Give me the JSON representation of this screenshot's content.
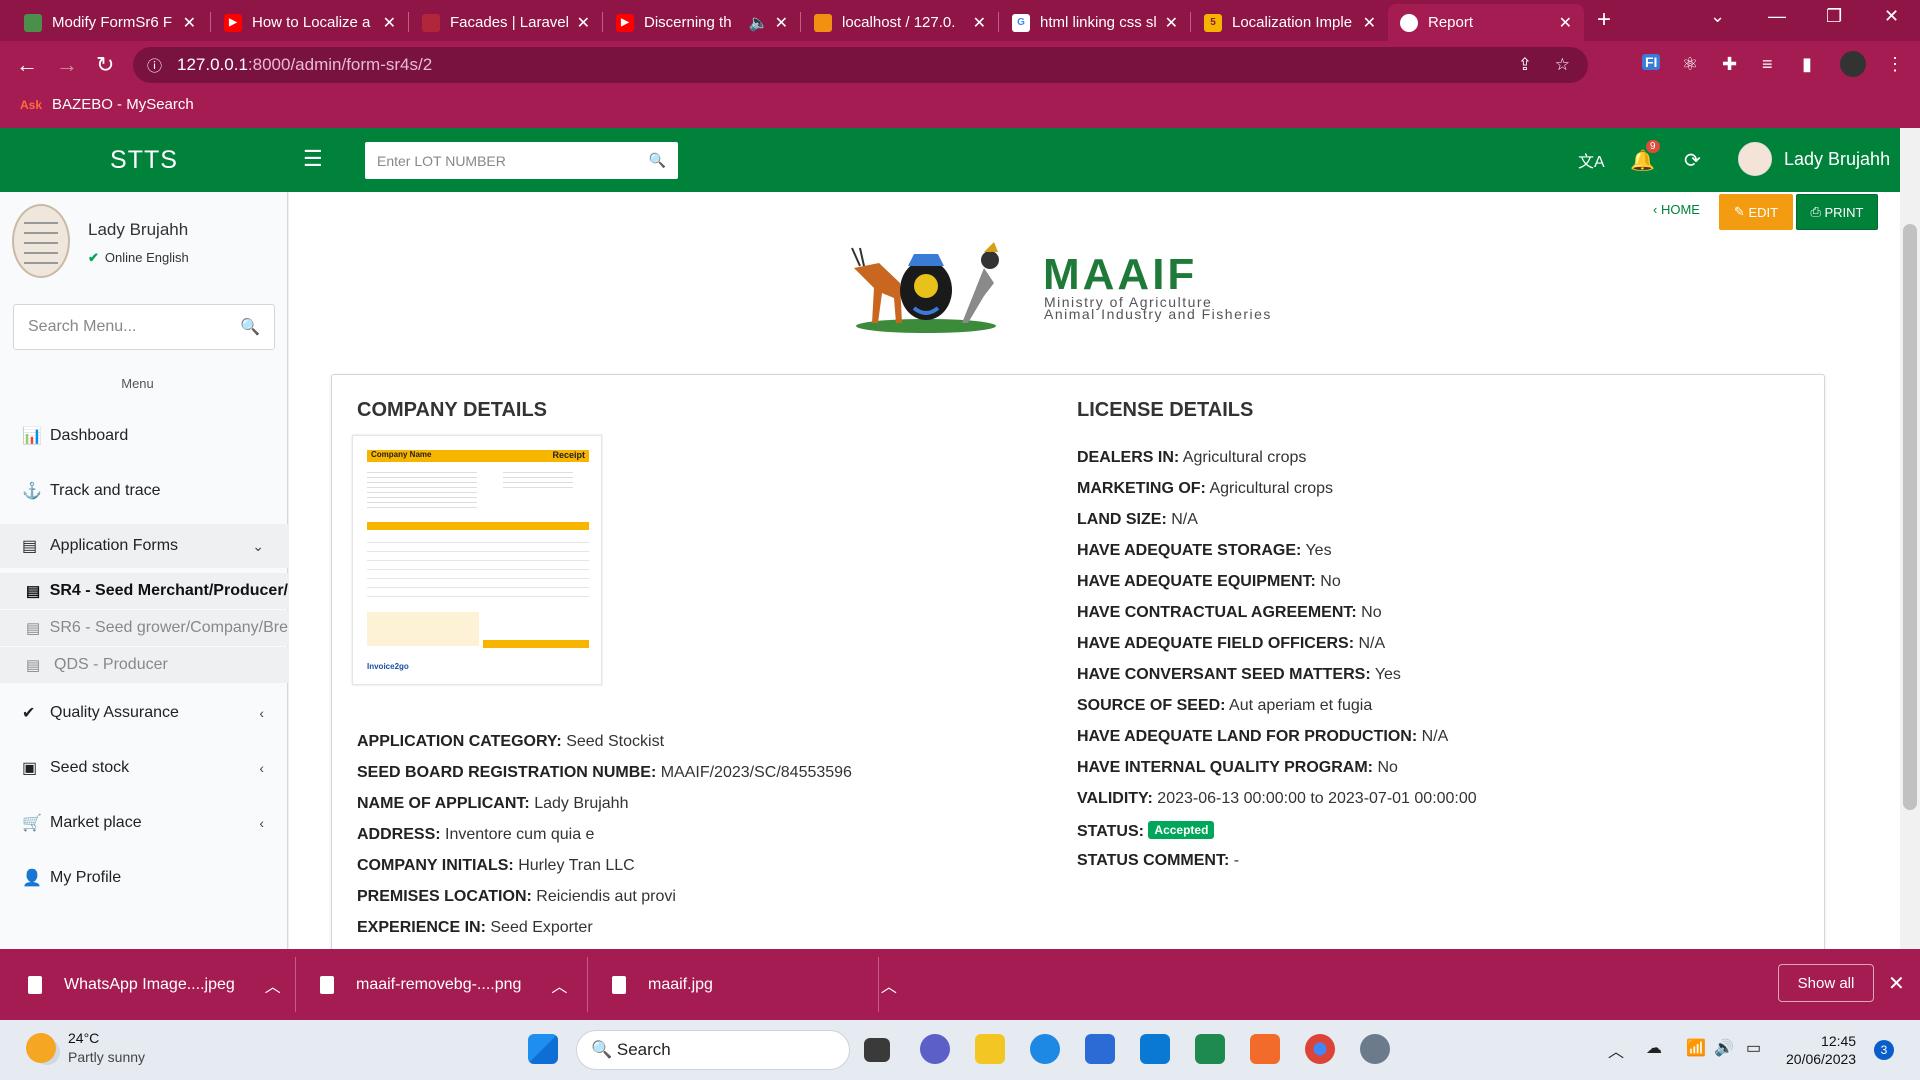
{
  "browser": {
    "tabs": [
      {
        "title": "Modify FormSr6 F",
        "icon": "globe-icon",
        "color": "#4a8f4a"
      },
      {
        "title": "How to Localize a",
        "icon": "youtube-icon",
        "color": "#ff0000"
      },
      {
        "title": "Facades | Laravel",
        "icon": "laravel-icon",
        "color": "#b2263b"
      },
      {
        "title": "Discerning th",
        "icon": "youtube-icon",
        "color": "#ff0000"
      },
      {
        "title": "localhost / 127.0.",
        "icon": "phpmyadmin-icon",
        "color": "#f29111"
      },
      {
        "title": "html linking css sl",
        "icon": "google-icon",
        "color": "#4285f4"
      },
      {
        "title": "Localization Imple",
        "icon": "tab-s-icon",
        "color": "#f5b400"
      },
      {
        "title": "Report",
        "icon": "globe-icon",
        "color": "#ffffff"
      }
    ],
    "url_host": "127.0.0.1",
    "url_path": ":8000/admin/form-sr4s/2",
    "bookmark": "BAZEBO - MySearch",
    "bookmark_icon": "Ask"
  },
  "header": {
    "logo": "STTS",
    "search_placeholder": "Enter LOT NUMBER",
    "notification_count": "9",
    "user_name": "Lady Brujahh"
  },
  "sidebar": {
    "user_name": "Lady Brujahh",
    "status": "Online English",
    "search_placeholder": "Search Menu...",
    "menu_header": "Menu",
    "items": [
      {
        "label": "Dashboard",
        "icon": "bar-chart-icon"
      },
      {
        "label": "Track and trace",
        "icon": "anchor-icon"
      },
      {
        "label": "Application Forms",
        "icon": "form-icon"
      },
      {
        "label": "Quality Assurance",
        "icon": "check-icon"
      },
      {
        "label": "Seed stock",
        "icon": "inbox-icon"
      },
      {
        "label": "Market place",
        "icon": "cart-icon"
      },
      {
        "label": "My Profile",
        "icon": "user-icon"
      }
    ],
    "subitems": [
      {
        "label": "SR4 - Seed Merchant/Producer/"
      },
      {
        "label": "SR6 - Seed grower/Company/Bre"
      },
      {
        "label": "QDS - Producer"
      }
    ]
  },
  "actions": {
    "home": "HOME",
    "edit": "EDIT",
    "print": "PRINT"
  },
  "brand": {
    "title": "MAAIF",
    "subtitle_1": "Ministry of Agriculture",
    "subtitle_2": "Animal Industry and Fisheries"
  },
  "company": {
    "heading": "COMPANY DETAILS",
    "receipt": {
      "company": "Company Name",
      "title": "Receipt",
      "footer": "Invoice2go"
    },
    "fields": [
      {
        "label": "APPLICATION CATEGORY:",
        "value": "Seed Stockist"
      },
      {
        "label": "SEED BOARD REGISTRATION NUMBE:",
        "value": "MAAIF/2023/SC/84553596"
      },
      {
        "label": "NAME OF APPLICANT:",
        "value": "Lady Brujahh"
      },
      {
        "label": "ADDRESS:",
        "value": "Inventore cum quia e"
      },
      {
        "label": "COMPANY INITIALS:",
        "value": "Hurley Tran LLC"
      },
      {
        "label": "PREMISES LOCATION:",
        "value": "Reiciendis aut provi"
      },
      {
        "label": "EXPERIENCE IN:",
        "value": "Seed Exporter"
      }
    ]
  },
  "license": {
    "heading": "LICENSE DETAILS",
    "fields": [
      {
        "label": "DEALERS IN:",
        "value": "Agricultural crops"
      },
      {
        "label": "MARKETING OF:",
        "value": "Agricultural crops"
      },
      {
        "label": "LAND SIZE:",
        "value": "N/A"
      },
      {
        "label": "HAVE ADEQUATE STORAGE:",
        "value": "Yes"
      },
      {
        "label": "HAVE ADEQUATE EQUIPMENT:",
        "value": "No"
      },
      {
        "label": "HAVE CONTRACTUAL AGREEMENT:",
        "value": "No"
      },
      {
        "label": "HAVE ADEQUATE FIELD OFFICERS:",
        "value": "N/A"
      },
      {
        "label": "HAVE CONVERSANT SEED MATTERS:",
        "value": "Yes"
      },
      {
        "label": "SOURCE OF SEED:",
        "value": "Aut aperiam et fugia"
      },
      {
        "label": "HAVE ADEQUATE LAND FOR PRODUCTION:",
        "value": "N/A"
      },
      {
        "label": "HAVE INTERNAL QUALITY PROGRAM:",
        "value": "No"
      },
      {
        "label": "VALIDITY:",
        "value": "2023-06-13 00:00:00 to 2023-07-01 00:00:00"
      },
      {
        "label": "STATUS:",
        "value": "Accepted"
      },
      {
        "label": "STATUS COMMENT:",
        "value": "-"
      }
    ]
  },
  "downloads": {
    "files": [
      "WhatsApp Image....jpeg",
      "maaif-removebg-....png",
      "maaif.jpg"
    ],
    "show_all": "Show all"
  },
  "taskbar": {
    "temp": "24°C",
    "weather": "Partly sunny",
    "search": "Search",
    "time": "12:45",
    "date": "20/06/2023",
    "notifications": "3"
  }
}
